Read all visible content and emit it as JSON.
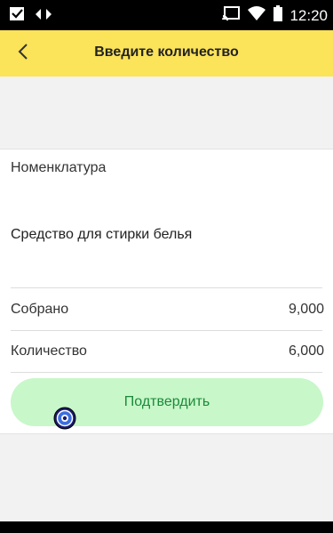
{
  "status_bar": {
    "time": "12:20",
    "icons_left": [
      "checkbox-notification-icon",
      "data-sync-icon"
    ],
    "icons_right": [
      "cast-icon",
      "wifi-icon",
      "battery-icon"
    ]
  },
  "header": {
    "title": "Введите количество",
    "back_icon": "chevron-left-icon",
    "background": "#fbe35a"
  },
  "card": {
    "nomenclature_label": "Номенклатура",
    "nomenclature_value": "Средство для стирки белья",
    "rows": [
      {
        "label": "Собрано",
        "value": "9,000"
      },
      {
        "label": "Количество",
        "value": "6,000"
      }
    ],
    "confirm_label": "Подтвердить",
    "confirm_color": "#c8f7c9",
    "confirm_text_color": "#1b8a3a"
  }
}
